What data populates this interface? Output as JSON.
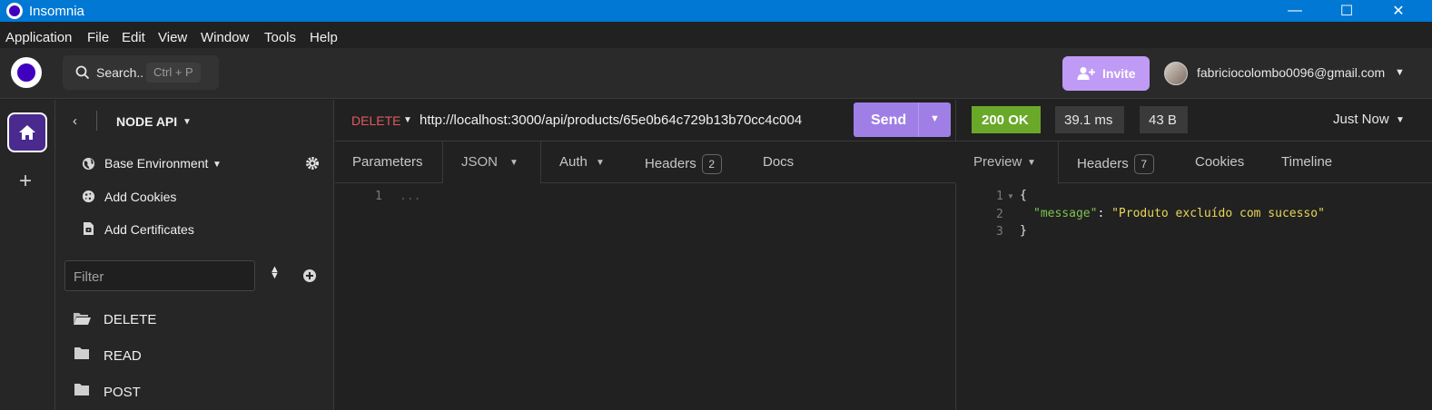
{
  "window": {
    "title": "Insomnia",
    "minimize": "—",
    "maximize": "☐",
    "close": "✕"
  },
  "menu": [
    "Application",
    "File",
    "Edit",
    "View",
    "Window",
    "Tools",
    "Help"
  ],
  "header": {
    "search_label": "Search..",
    "search_shortcut": "Ctrl + P",
    "invite_label": "Invite",
    "user_email": "fabriciocolombo0096@gmail.com"
  },
  "sidebar": {
    "project_name": "NODE API",
    "environment": "Base Environment",
    "add_cookies": "Add Cookies",
    "add_certificates": "Add Certificates",
    "filter_placeholder": "Filter",
    "folders": [
      {
        "label": "DELETE",
        "open": true
      },
      {
        "label": "READ",
        "open": false
      },
      {
        "label": "POST",
        "open": false
      }
    ]
  },
  "request": {
    "method": "DELETE",
    "url": "http://localhost:3000/api/products/65e0b64c729b13b70cc4c004",
    "send_label": "Send",
    "tabs": {
      "parameters": "Parameters",
      "body": "JSON",
      "auth": "Auth",
      "headers": "Headers",
      "headers_count": "2",
      "docs": "Docs"
    },
    "editor": {
      "line_number": "1",
      "placeholder": "..."
    }
  },
  "response": {
    "status": "200 OK",
    "time": "39.1 ms",
    "size": "43 B",
    "history_label": "Just Now",
    "tabs": {
      "preview": "Preview",
      "headers": "Headers",
      "headers_count": "7",
      "cookies": "Cookies",
      "timeline": "Timeline"
    },
    "body_lines": [
      {
        "n": "1",
        "text": "{"
      },
      {
        "n": "2",
        "key": "\"message\"",
        "colon": ": ",
        "value": "\"Produto excluído com sucesso\""
      },
      {
        "n": "3",
        "text": "}"
      }
    ]
  },
  "colors": {
    "titlebar": "#0078d4",
    "accent": "#4000bf",
    "send_button": "#9f7fe6",
    "invite_button": "#bf9bf5",
    "status_ok": "#6aa82a",
    "method_delete": "#e05a5a",
    "json_key": "#7ec24e",
    "json_string": "#e8d656"
  }
}
